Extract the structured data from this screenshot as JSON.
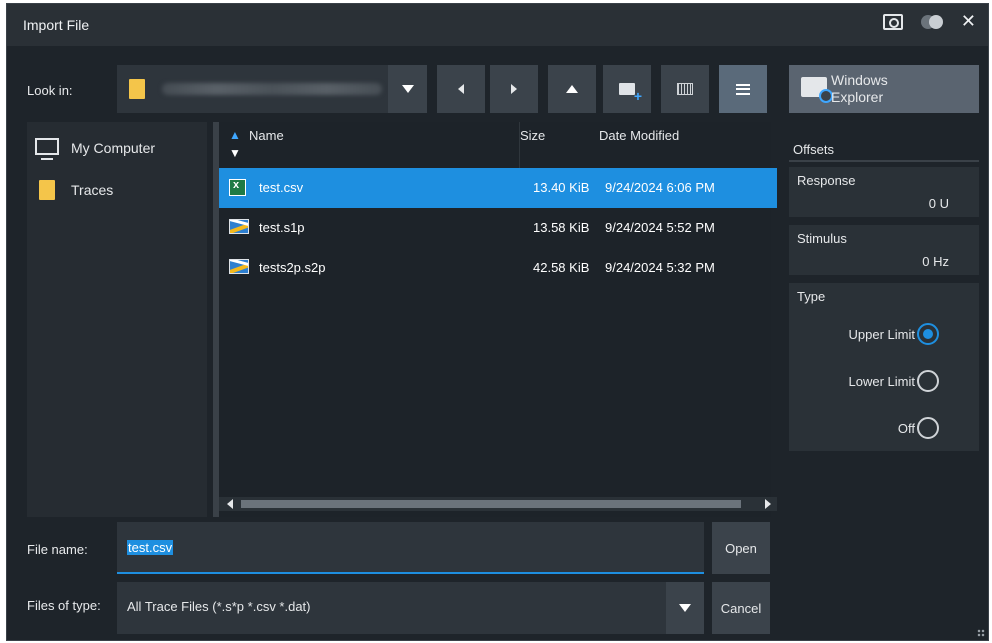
{
  "window": {
    "title": "Import File"
  },
  "titlebar_icons": [
    "camera-icon",
    "toggle-icon",
    "close-icon"
  ],
  "lookin": {
    "label": "Look in:",
    "path_hidden": true
  },
  "toolbar": {
    "buttons": [
      "dropdown",
      "back",
      "forward",
      "up",
      "new-folder",
      "columns-view",
      "list-view"
    ],
    "explorer_label_line1": "Windows",
    "explorer_label_line2": "Explorer"
  },
  "places": [
    {
      "label": "My Computer",
      "icon": "monitor-icon"
    },
    {
      "label": "Traces",
      "icon": "folder-icon"
    }
  ],
  "columns": {
    "name": "Name",
    "size": "Size",
    "date": "Date Modified"
  },
  "files": [
    {
      "name": "test.csv",
      "size": "13.40 KiB",
      "date": "9/24/2024 6:06 PM",
      "icon": "excel-icon",
      "selected": true
    },
    {
      "name": "test.s1p",
      "size": "13.58 KiB",
      "date": "9/24/2024 5:52 PM",
      "icon": "trace-file-icon",
      "selected": false
    },
    {
      "name": "tests2p.s2p",
      "size": "42.58 KiB",
      "date": "9/24/2024 5:32 PM",
      "icon": "trace-file-icon",
      "selected": false
    }
  ],
  "filename": {
    "label": "File name:",
    "value": "test.csv"
  },
  "filetype": {
    "label": "Files of type:",
    "value": "All Trace Files (*.s*p *.csv *.dat)"
  },
  "buttons": {
    "open": "Open",
    "cancel": "Cancel"
  },
  "offsets": {
    "title": "Offsets",
    "response_label": "Response",
    "response_value": "0 U",
    "stimulus_label": "Stimulus",
    "stimulus_value": "0 Hz"
  },
  "type": {
    "title": "Type",
    "options": [
      "Upper Limit",
      "Lower Limit",
      "Off"
    ],
    "selected": "Upper Limit"
  },
  "colors": {
    "accent": "#1e8fe0",
    "background": "#1e242a",
    "panel": "#2a3137"
  }
}
